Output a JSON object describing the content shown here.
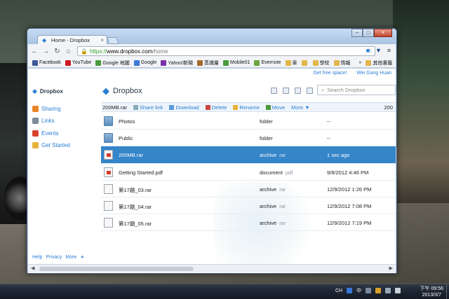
{
  "browser": {
    "tab_title": "Home - Dropbox",
    "url_scheme": "https://",
    "url_host": "www.dropbox.com",
    "url_path": "/home",
    "bookmarks": [
      {
        "label": "Facebook",
        "color": "#3b5998"
      },
      {
        "label": "YouTube",
        "color": "#cc181e"
      },
      {
        "label": "Google 地圖",
        "color": "#4a9a3a"
      },
      {
        "label": "Google",
        "color": "#3a78d8"
      },
      {
        "label": "Yahoo!新聞",
        "color": "#7b2fa8"
      },
      {
        "label": "蒸燻量",
        "color": "#a36a2a"
      },
      {
        "label": "Mobile01",
        "color": "#4a9a3a"
      },
      {
        "label": "Evernote",
        "color": "#6aa33a"
      },
      {
        "label": "車",
        "color": "#e2b64a"
      },
      {
        "label": "",
        "color": "#e2b64a"
      },
      {
        "label": "學校",
        "color": "#e2b64a"
      },
      {
        "label": "情報",
        "color": "#e2b64a"
      },
      {
        "label": "其他書籤",
        "color": "#e2b64a"
      }
    ],
    "overflow": "»"
  },
  "page": {
    "top_links": {
      "free_space": "Get free space!",
      "user": "Wei Gang Huan"
    },
    "brand": "Dropbox",
    "sidebar": {
      "items": [
        {
          "label": "Sharing",
          "color": "#e8862a"
        },
        {
          "label": "Links",
          "color": "#7c8a99"
        },
        {
          "label": "Events",
          "color": "#d9432e"
        },
        {
          "label": "Get Started",
          "color": "#e9b23a"
        }
      ],
      "footer": [
        "Help",
        "Privacy",
        "More",
        "▲"
      ]
    },
    "main": {
      "title": "Dropbox",
      "search_placeholder": "Search Dropbox",
      "selected_file": "200MB.rar",
      "actions": [
        "Share link",
        "Download",
        "Delete",
        "Rename",
        "Move",
        "More ▼"
      ],
      "count": "200",
      "files": [
        {
          "name": "Photos",
          "kind": "folder",
          "ext": "",
          "modified": "--",
          "icon": "folder-icon",
          "selected": false
        },
        {
          "name": "Public",
          "kind": "folder",
          "ext": "",
          "modified": "--",
          "icon": "folder-icon",
          "selected": false
        },
        {
          "name": "200MB.rar",
          "kind": "archive",
          "ext": "rar",
          "modified": "1 sec ago",
          "icon": "pdf-file-icon",
          "selected": true
        },
        {
          "name": "Getting Started.pdf",
          "kind": "document",
          "ext": "pdf",
          "modified": "9/8/2012 4:46 PM",
          "icon": "pdf-file-icon",
          "selected": false
        },
        {
          "name": "第17題_03.rar",
          "kind": "archive",
          "ext": "rar",
          "modified": "12/9/2012 1:26 PM",
          "icon": "file-icon",
          "selected": false
        },
        {
          "name": "第17題_04.rar",
          "kind": "archive",
          "ext": "rar",
          "modified": "12/9/2012 7:08 PM",
          "icon": "file-icon",
          "selected": false
        },
        {
          "name": "第17題_05.rar",
          "kind": "archive",
          "ext": "rar",
          "modified": "12/9/2012 7:19 PM",
          "icon": "file-icon",
          "selected": false
        }
      ]
    }
  },
  "taskbar": {
    "tray": [
      "CH",
      "中"
    ],
    "time": "下午 09:56",
    "date": "2013/3/7"
  }
}
